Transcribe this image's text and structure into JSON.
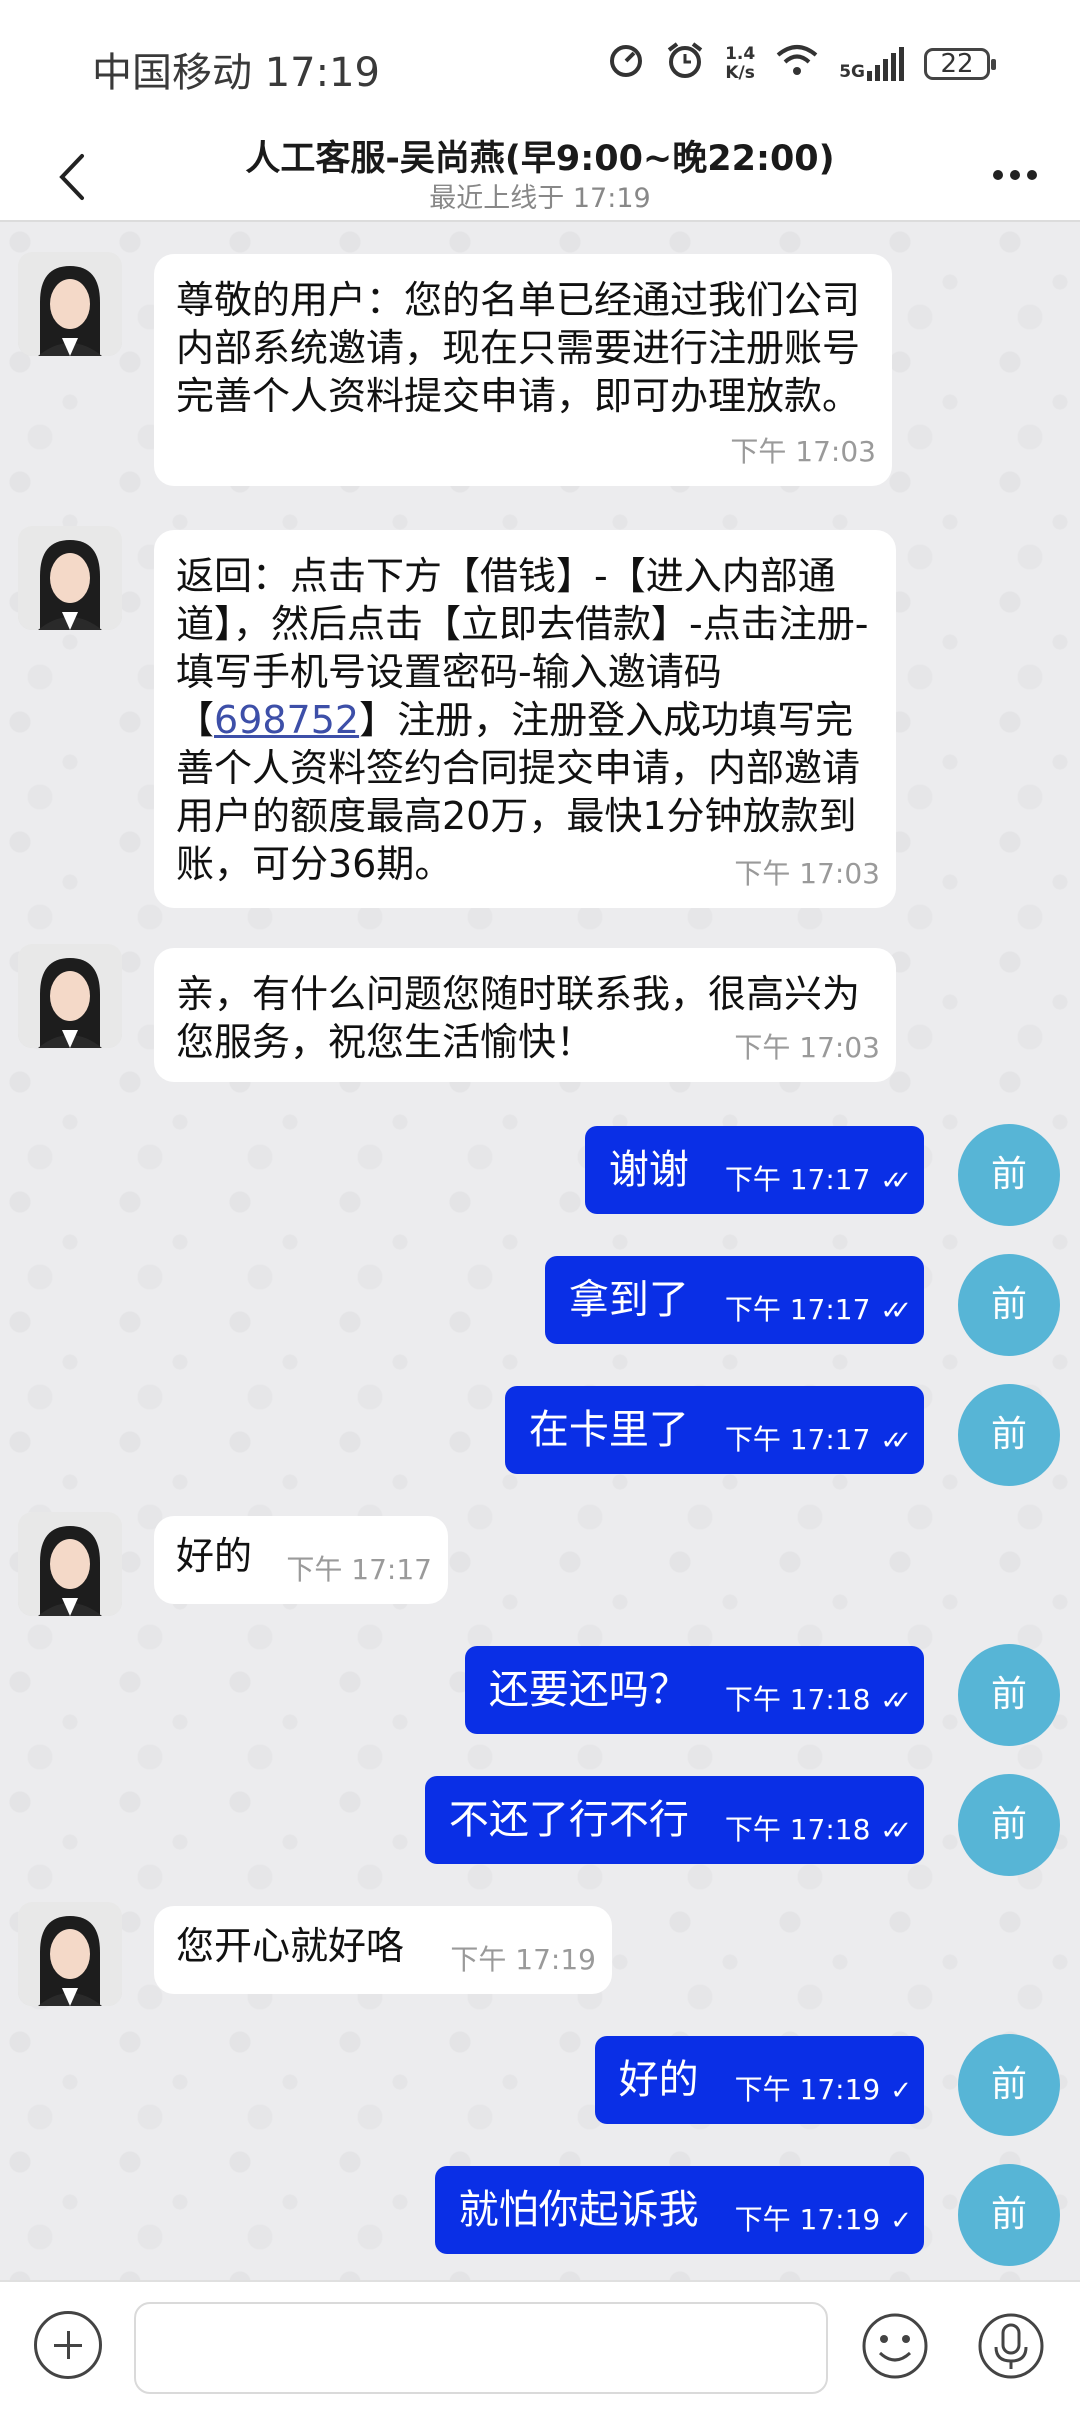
{
  "status": {
    "carrier": "中国移动",
    "time": "17:19",
    "net_speed_value": "1.4",
    "net_speed_unit": "K/s",
    "network": "5G",
    "battery": "22"
  },
  "header": {
    "title": "人工客服-吴尚燕(早9:00~晚22:00)",
    "subtitle": "最近上线于 17:19"
  },
  "messages": [
    {
      "dir": "in",
      "text": "尊敬的用户：您的名单已经通过我们公司内部系统邀请，现在只需要进行注册账号完善个人资料提交申请，即可办理放款。",
      "time": "下午 17:03"
    },
    {
      "dir": "in",
      "text_before": "返回：点击下方【借钱】-【进入内部通道】，然后点击【立即去借款】-点击注册-填写手机号设置密码-输入邀请码【",
      "link": "698752",
      "text_after": "】注册，注册登入成功填写完善个人资料签约合同提交申请，内部邀请用户的额度最高20万，最快1分钟放款到账，可分36期。",
      "time": "下午 17:03"
    },
    {
      "dir": "in",
      "text": "亲，有什么问题您随时联系我，很高兴为您服务，祝您生活愉快！",
      "time": "下午 17:03"
    },
    {
      "dir": "out",
      "text": "谢谢",
      "time": "下午 17:17",
      "status": "read"
    },
    {
      "dir": "out",
      "text": "拿到了",
      "time": "下午 17:17",
      "status": "read"
    },
    {
      "dir": "out",
      "text": "在卡里了",
      "time": "下午 17:17",
      "status": "read"
    },
    {
      "dir": "in",
      "text": "好的",
      "time": "下午 17:17"
    },
    {
      "dir": "out",
      "text": "还要还吗？",
      "time": "下午 17:18",
      "status": "read"
    },
    {
      "dir": "out",
      "text": "不还了行不行",
      "time": "下午 17:18",
      "status": "read"
    },
    {
      "dir": "in",
      "text": "您开心就好咯",
      "time": "下午 17:19"
    },
    {
      "dir": "out",
      "text": "好的",
      "time": "下午 17:19",
      "status": "sent"
    },
    {
      "dir": "out",
      "text": "就怕你起诉我",
      "time": "下午 17:19",
      "status": "sent"
    }
  ],
  "self_avatar_label": "前",
  "composer": {
    "placeholder": ""
  },
  "colors": {
    "outgoing_bubble": "#0a2fe6",
    "incoming_bubble": "#ffffff",
    "self_avatar": "#57b5d6"
  }
}
